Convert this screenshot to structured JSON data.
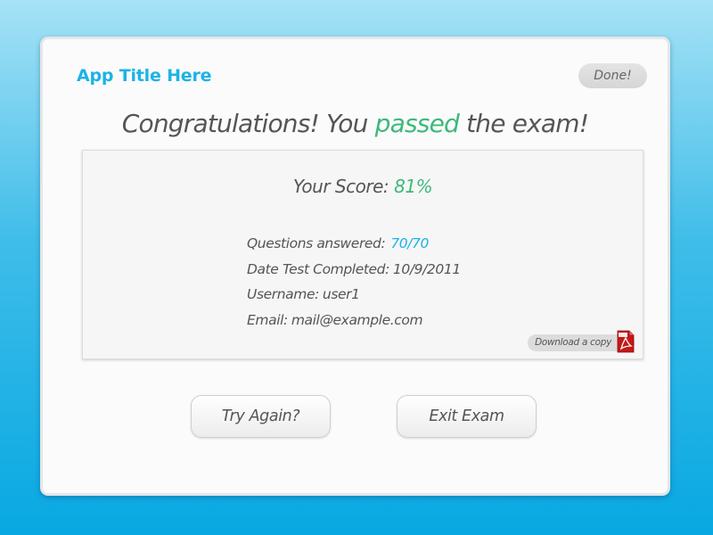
{
  "app": {
    "title": "App Title Here",
    "done_label": "Done!"
  },
  "headline": {
    "before": "Congratulations! You ",
    "highlight": "passed",
    "after": " the exam!"
  },
  "score": {
    "label": "Your Score:",
    "value": "81%"
  },
  "details": {
    "questions_label": "Questions answered:",
    "questions_value": "70/70",
    "date_label": "Date Test Completed:",
    "date_value": "10/9/2011",
    "username_label": "Username:",
    "username_value": "user1",
    "email_label": "Email:",
    "email_value": "mail@example.com"
  },
  "download": {
    "label": "Download a copy",
    "icon": "pdf-icon"
  },
  "actions": {
    "try_again": "Try Again?",
    "exit": "Exit Exam"
  },
  "colors": {
    "accent_blue": "#1cb3e6",
    "accent_green": "#3eb87a",
    "pdf_red": "#c41818"
  }
}
